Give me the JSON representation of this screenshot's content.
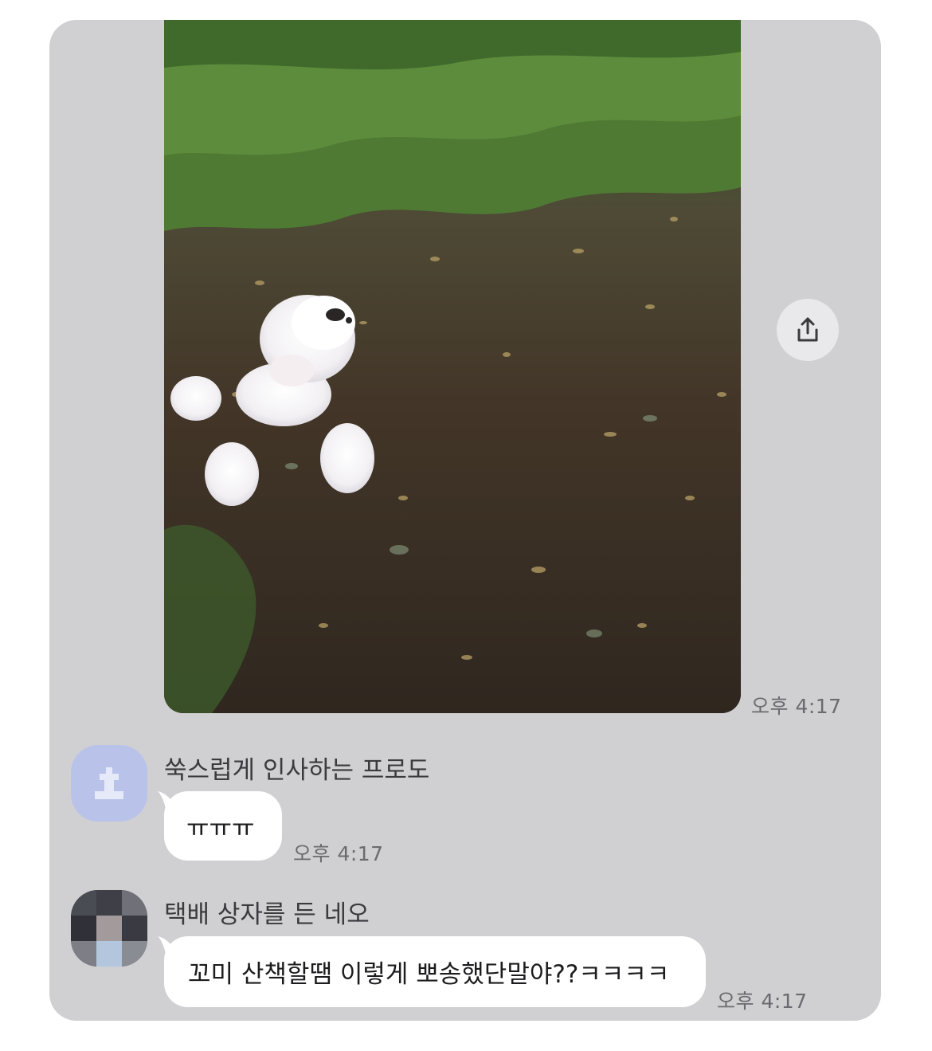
{
  "messages": {
    "photo": {
      "timestamp": "오후 4:17",
      "share_icon": "share-upload-icon"
    },
    "message_1": {
      "sender": "쑥스럽게 인사하는 프로도",
      "text": "ㅠㅠㅠ",
      "timestamp": "오후 4:17",
      "avatar_icon": "default-avatar-icon"
    },
    "message_2": {
      "sender": "택배 상자를 든 네오",
      "text": "꼬미 산책할땜 이렇게 뽀송했단말야??ㅋㅋㅋㅋ",
      "timestamp": "오후 4:17",
      "avatar_icon": "pixelated-avatar"
    }
  },
  "colors": {
    "panel_background": "#d0d0d2",
    "bubble": "#ffffff",
    "default_avatar": "#b9c3ea",
    "share_button": "#e9e9eb"
  }
}
